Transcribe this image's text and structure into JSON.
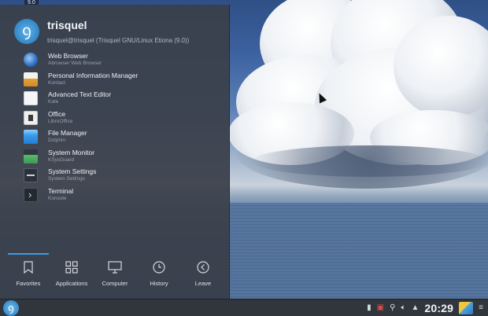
{
  "desktop": {
    "version_label": "9.0"
  },
  "launcher": {
    "user_name": "trisquel",
    "user_subtitle": "trisquel@trisquel (Trisquel GNU/Linux Etiona (9.0))",
    "favorites": [
      {
        "title": "Web Browser",
        "desc": "Abrowser Web Browser",
        "icon": "web-browser-icon"
      },
      {
        "title": "Personal Information Manager",
        "desc": "Kontact",
        "icon": "kontact-icon"
      },
      {
        "title": "Advanced Text Editor",
        "desc": "Kate",
        "icon": "kate-icon"
      },
      {
        "title": "Office",
        "desc": "LibreOffice",
        "icon": "libreoffice-icon"
      },
      {
        "title": "File Manager",
        "desc": "Dolphin",
        "icon": "dolphin-icon"
      },
      {
        "title": "System Monitor",
        "desc": "KSysGuard",
        "icon": "ksysguard-icon"
      },
      {
        "title": "System Settings",
        "desc": "System Settings",
        "icon": "system-settings-icon"
      },
      {
        "title": "Terminal",
        "desc": "Konsole",
        "icon": "konsole-icon"
      }
    ],
    "tabs": [
      {
        "label": "Favorites",
        "icon": "bookmark-icon",
        "active": true
      },
      {
        "label": "Applications",
        "icon": "grid-icon",
        "active": false
      },
      {
        "label": "Computer",
        "icon": "monitor-icon",
        "active": false
      },
      {
        "label": "History",
        "icon": "clock-icon",
        "active": false
      },
      {
        "label": "Leave",
        "icon": "leave-icon",
        "active": false
      }
    ],
    "accent_color": "#3d9be0"
  },
  "taskbar": {
    "clock": "20:29",
    "tray_icons": [
      "usb-icon",
      "network-icon",
      "user-switch-icon",
      "volume-icon",
      "expand-tray-icon"
    ]
  }
}
